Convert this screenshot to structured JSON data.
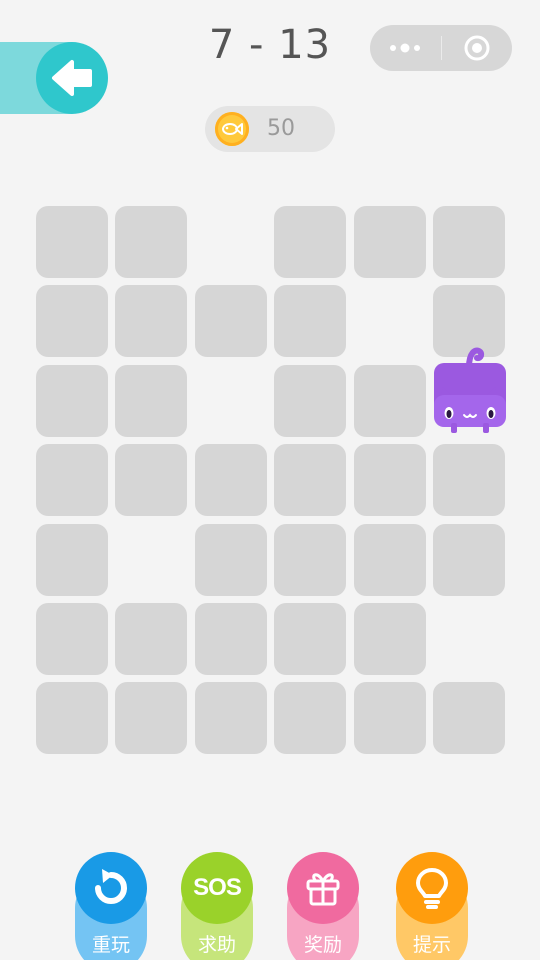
{
  "header": {
    "level": "7 - 13",
    "back_icon": "left-arrow-icon",
    "menu_icon": "more-dots-icon",
    "close_icon": "target-circle-icon"
  },
  "coins": {
    "icon": "fish-coin-icon",
    "value": "50"
  },
  "board": {
    "rows": 7,
    "cols": 6,
    "layout": [
      "11.111",
      "1111.1",
      "11.11C",
      "111111",
      "1.1111",
      "11111.",
      "111111"
    ],
    "tile_color": "#d6d6d6",
    "cat": {
      "row": 2,
      "col": 5,
      "color": "#9b59e0"
    }
  },
  "actions": [
    {
      "id": "replay",
      "label": "重玩",
      "icon": "replay-arrow-icon",
      "color": "#199ae6"
    },
    {
      "id": "sos",
      "label": "求助",
      "icon": "sos-icon",
      "icon_text": "SOS",
      "color": "#9ad22a"
    },
    {
      "id": "reward",
      "label": "奖励",
      "icon": "gift-icon",
      "color": "#f06a9f"
    },
    {
      "id": "hint",
      "label": "提示",
      "icon": "lightbulb-icon",
      "color": "#ff9d0d"
    }
  ]
}
